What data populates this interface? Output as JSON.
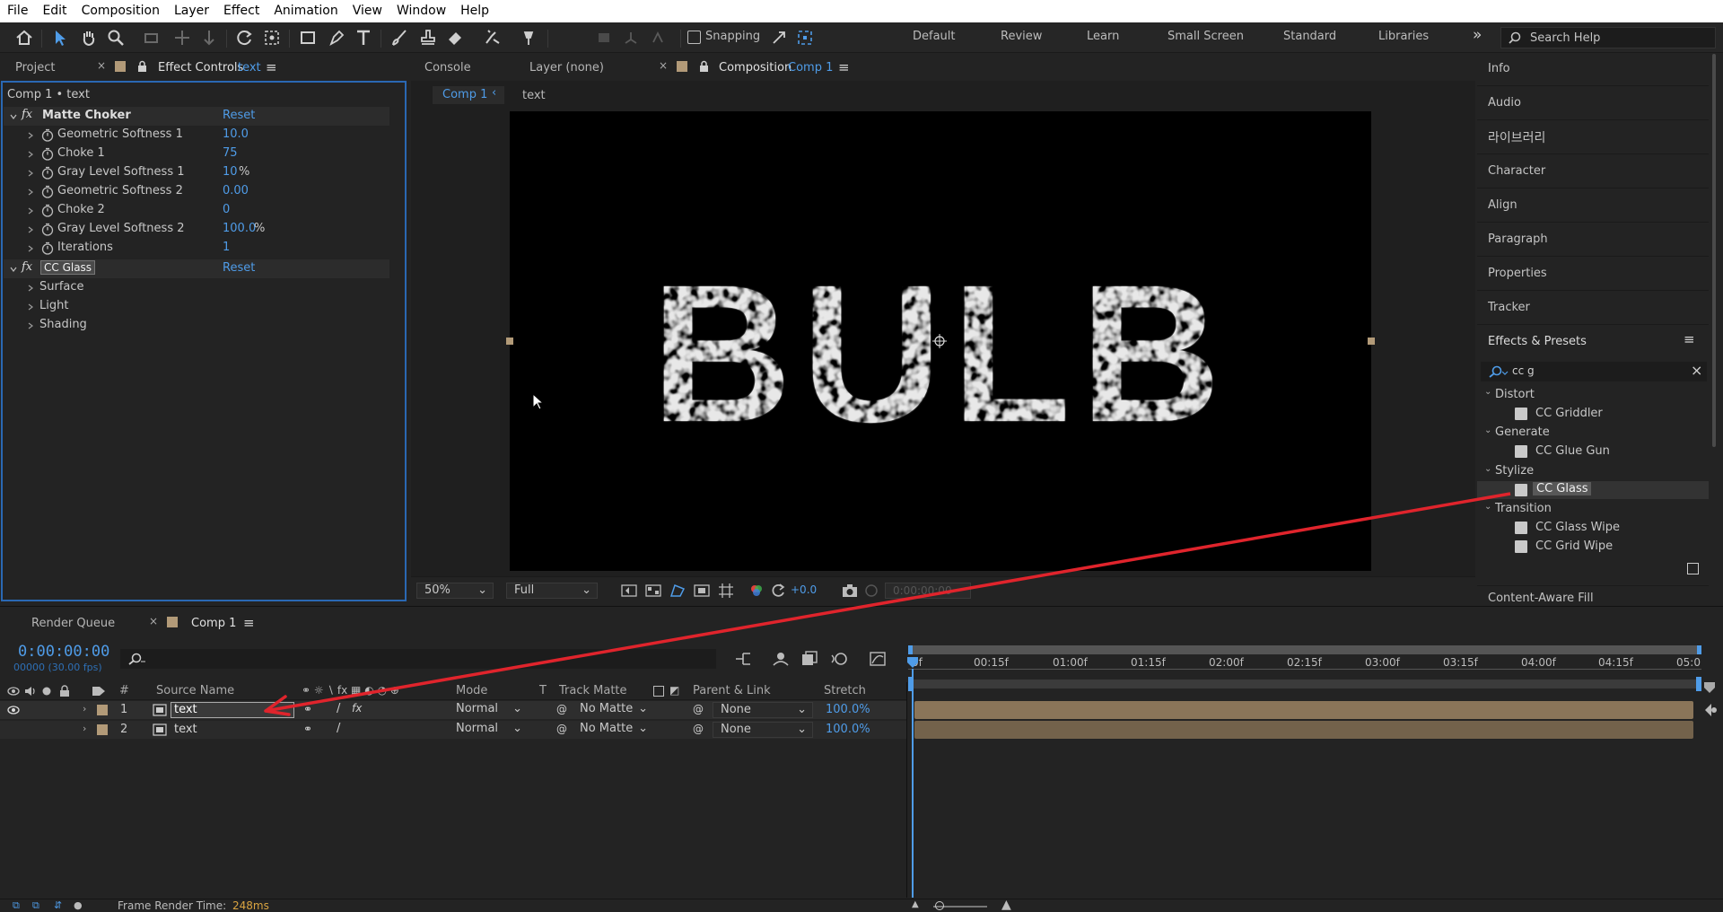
{
  "menu": [
    "File",
    "Edit",
    "Composition",
    "Layer",
    "Effect",
    "Animation",
    "View",
    "Window",
    "Help"
  ],
  "toolbar": {
    "snapping_label": "Snapping",
    "workspaces": [
      "Default",
      "Review",
      "Learn",
      "Small Screen",
      "Standard",
      "Libraries"
    ],
    "search_help_placeholder": "Search Help"
  },
  "left_panel": {
    "tab_project": "Project",
    "tab_effect_controls": "Effect Controls",
    "tab_effect_controls_target": "text",
    "breadcrumb": "Comp 1 • text",
    "effects": [
      {
        "name": "Matte Choker",
        "reset": "Reset",
        "props": [
          {
            "name": "Geometric Softness 1",
            "value": "10.0",
            "unit": ""
          },
          {
            "name": "Choke 1",
            "value": "75",
            "unit": ""
          },
          {
            "name": "Gray Level Softness 1",
            "value": "10",
            "unit": "%"
          },
          {
            "name": "Geometric Softness 2",
            "value": "0.00",
            "unit": ""
          },
          {
            "name": "Choke 2",
            "value": "0",
            "unit": ""
          },
          {
            "name": "Gray Level Softness 2",
            "value": "100.0",
            "unit": "%"
          },
          {
            "name": "Iterations",
            "value": "1",
            "unit": ""
          }
        ]
      },
      {
        "name": "CC Glass",
        "reset": "Reset",
        "groups": [
          "Surface",
          "Light",
          "Shading"
        ]
      }
    ]
  },
  "viewer": {
    "tab_console": "Console",
    "tab_layer": "Layer (none)",
    "tab_composition": "Composition",
    "tab_composition_target": "Comp 1",
    "nav_comp": "Comp 1",
    "nav_layer": "text",
    "canvas_text": "BULB",
    "zoom": "50%",
    "resolution": "Full",
    "exposure": "+0.0",
    "timecode": "0:00:00:00"
  },
  "right_panel": {
    "items": [
      "Info",
      "Audio",
      "라이브러리",
      "Character",
      "Align",
      "Paragraph",
      "Properties",
      "Tracker"
    ],
    "effects_presets_title": "Effects & Presets",
    "search_value": "cc g",
    "categories": [
      {
        "name": "Distort",
        "items": [
          "CC Griddler"
        ]
      },
      {
        "name": "Generate",
        "items": [
          "CC Glue Gun"
        ]
      },
      {
        "name": "Stylize",
        "items": [
          "CC Glass"
        ]
      },
      {
        "name": "Transition",
        "items": [
          "CC Glass Wipe",
          "CC Grid Wipe"
        ]
      }
    ],
    "content_aware_fill": "Content-Aware Fill"
  },
  "timeline": {
    "tab_render_queue": "Render Queue",
    "tab_comp": "Comp 1",
    "timecode": "0:00:00:00",
    "frame_info": "00000 (30.00 fps)",
    "headers": {
      "num": "#",
      "source_name": "Source Name",
      "mode": "Mode",
      "t": "T",
      "track_matte": "Track Matte",
      "parent": "Parent & Link",
      "stretch": "Stretch"
    },
    "ruler": [
      "0f",
      "00:15f",
      "01:00f",
      "01:15f",
      "02:00f",
      "02:15f",
      "03:00f",
      "03:15f",
      "04:00f",
      "04:15f",
      "05:0"
    ],
    "layers": [
      {
        "num": "1",
        "name": "text",
        "mode": "Normal",
        "matte": "No Matte",
        "parent": "None",
        "stretch": "100.0%"
      },
      {
        "num": "2",
        "name": "text",
        "mode": "Normal",
        "matte": "No Matte",
        "parent": "None",
        "stretch": "100.0%"
      }
    ]
  },
  "status_bar": {
    "frame_render_label": "Frame Render Time:",
    "frame_render_value": "248ms"
  },
  "colors": {
    "accent_blue": "#4f9ce8",
    "annotation_arrow": "#e0242c",
    "label_tan": "#b29a78",
    "clip_bar": "#8a7559"
  }
}
